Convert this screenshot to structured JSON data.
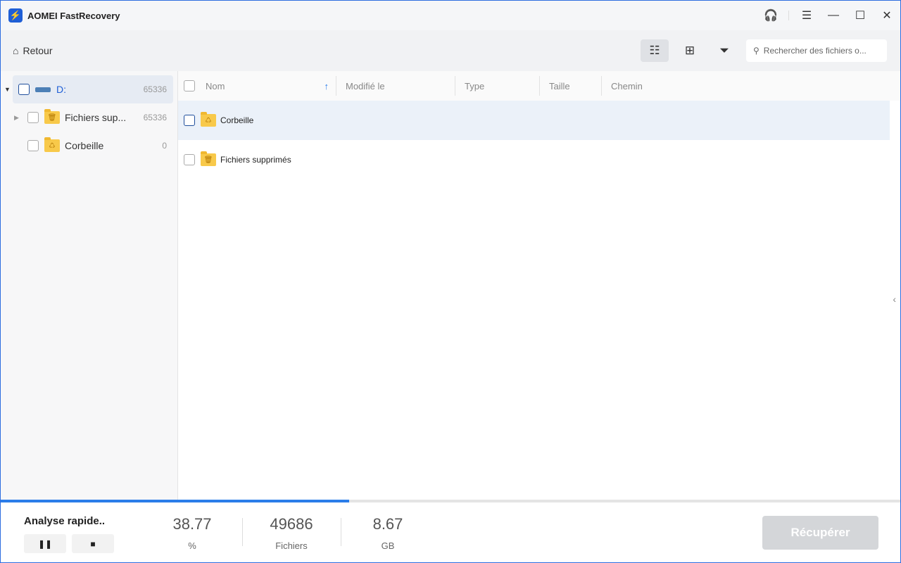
{
  "app": {
    "title": "AOMEI FastRecovery"
  },
  "toolbar": {
    "back_label": "Retour",
    "search_placeholder": "Rechercher des fichiers o..."
  },
  "tree": [
    {
      "label": "D:",
      "count": "65336"
    },
    {
      "label": "Fichiers sup...",
      "count": "65336"
    },
    {
      "label": "Corbeille",
      "count": "0"
    }
  ],
  "table": {
    "columns": [
      "Nom",
      "Modifié le",
      "Type",
      "Taille",
      "Chemin"
    ],
    "rows": [
      {
        "name": "Corbeille"
      },
      {
        "name": "Fichiers supprimés"
      }
    ]
  },
  "footer": {
    "status": "Analyse rapide..",
    "percent": "38.77",
    "percent_label": "%",
    "files": "49686",
    "files_label": "Fichiers",
    "size": "8.67",
    "size_label": "GB",
    "recover_label": "Récupérer",
    "progress_fraction": 0.3877
  },
  "colors": {
    "accent": "#2b7de9",
    "border": "#2d6de0"
  }
}
